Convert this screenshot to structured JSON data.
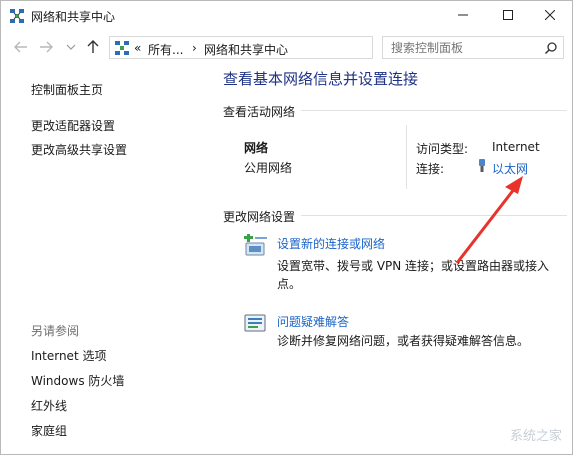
{
  "window": {
    "title": "网络和共享中心"
  },
  "address": {
    "overflow": "«",
    "crumb1": "所有...",
    "sep1": "›",
    "crumb2": "网络和共享中心",
    "dropdown": "⌄"
  },
  "search": {
    "placeholder": "搜索控制面板"
  },
  "leftpane": {
    "home": "控制面板主页",
    "adapter": "更改适配器设置",
    "sharing": "更改高级共享设置",
    "seealso_header": "另请参阅",
    "seealso": [
      "Internet 选项",
      "Windows 防火墙",
      "红外线",
      "家庭组"
    ]
  },
  "main": {
    "title": "查看基本网络信息并设置连接",
    "active_header": "查看活动网络",
    "network_name": "网络",
    "network_type": "公用网络",
    "access_label": "访问类型:",
    "access_value": "Internet",
    "connection_label": "连接:",
    "connection_value": "以太网",
    "change_header": "更改网络设置",
    "tasks": [
      {
        "title": "设置新的连接或网络",
        "desc": "设置宽带、拨号或 VPN 连接；或设置路由器或接入点。"
      },
      {
        "title": "问题疑难解答",
        "desc": "诊断并修复网络问题，或者获得疑难解答信息。"
      }
    ]
  },
  "watermark": "系统之家",
  "colors": {
    "link": "#1b64c8",
    "title_blue": "#1e3287",
    "annotation_arrow": "#e8322a"
  }
}
